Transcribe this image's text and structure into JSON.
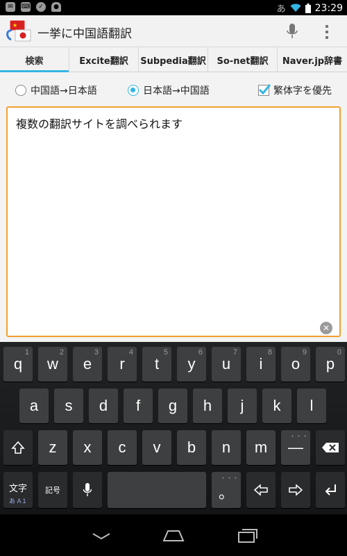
{
  "status_bar": {
    "ime_indicator": "あ",
    "time": "23:29",
    "icons": [
      "notification-icon",
      "keyboard-icon",
      "check-icon",
      "android-icon",
      "wifi-icon",
      "battery-icon"
    ]
  },
  "action_bar": {
    "title": "一挙に中国語翻訳",
    "icons": [
      "app-logo-icon",
      "microphone-icon",
      "overflow-menu-icon"
    ]
  },
  "tabs": [
    {
      "label": "検索",
      "active": true
    },
    {
      "label": "Excite翻訳",
      "active": false
    },
    {
      "label": "Subpedia翻訳",
      "active": false
    },
    {
      "label": "So-net翻訳",
      "active": false
    },
    {
      "label": "Naver.jp辞書",
      "active": false
    }
  ],
  "options": {
    "zh_to_ja": {
      "label": "中国語→日本語",
      "selected": false
    },
    "ja_to_zh": {
      "label": "日本語→中国語",
      "selected": true
    },
    "traditional": {
      "label": "繁体字を優先",
      "checked": true
    }
  },
  "input": {
    "value": "複数の翻訳サイトを調べられます"
  },
  "keyboard": {
    "row1": [
      {
        "key": "q",
        "hint": "1"
      },
      {
        "key": "w",
        "hint": "2"
      },
      {
        "key": "e",
        "hint": "3"
      },
      {
        "key": "r",
        "hint": "4"
      },
      {
        "key": "t",
        "hint": "5"
      },
      {
        "key": "y",
        "hint": "6"
      },
      {
        "key": "u",
        "hint": "7"
      },
      {
        "key": "i",
        "hint": "8"
      },
      {
        "key": "o",
        "hint": "9"
      },
      {
        "key": "p",
        "hint": "0"
      }
    ],
    "row2": [
      "a",
      "s",
      "d",
      "f",
      "g",
      "h",
      "j",
      "k",
      "l"
    ],
    "row3": [
      "z",
      "x",
      "c",
      "v",
      "b",
      "n",
      "m"
    ],
    "dash_key": "—",
    "dash_hint": "・・・",
    "mode_key": "文字",
    "mode_sub": "あ A 1",
    "symbol_key": "記号",
    "period_key": "。",
    "period_hint": "・・・",
    "accent": "#33b5e5"
  },
  "colors": {
    "tab_indicator": "#33b5e5",
    "input_border": "#f0a030"
  }
}
